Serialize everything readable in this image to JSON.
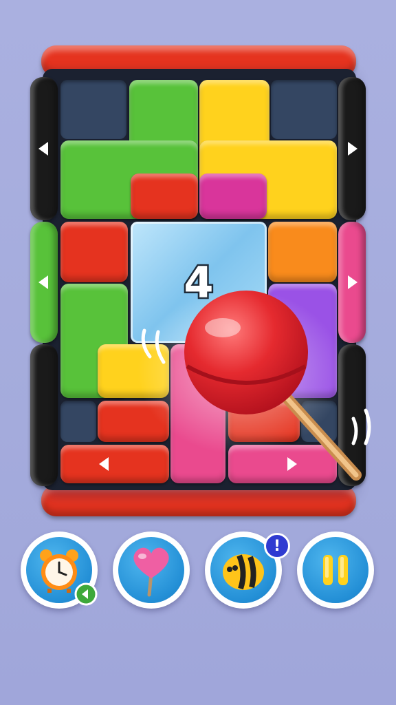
{
  "level_ice": {
    "count": "4"
  },
  "colors": {
    "red": "#e5331f",
    "green": "#58c23a",
    "yellow": "#ffd21d",
    "pink": "#ea4a8e",
    "orange": "#f98b1c",
    "purple": "#9a52e6",
    "dark_slot": "#344662",
    "black_rail": "#1a1a1a",
    "button_blue": "#238fd6"
  },
  "boosters": [
    {
      "name": "alarm-clock",
      "icon": "alarm-clock-icon"
    },
    {
      "name": "heart-lollipop",
      "icon": "heart-lollipop-icon"
    },
    {
      "name": "bee",
      "icon": "bee-icon",
      "badge": "!"
    },
    {
      "name": "pause",
      "icon": "pause-icon"
    }
  ],
  "hint": {
    "icon": "lollipop-icon"
  }
}
